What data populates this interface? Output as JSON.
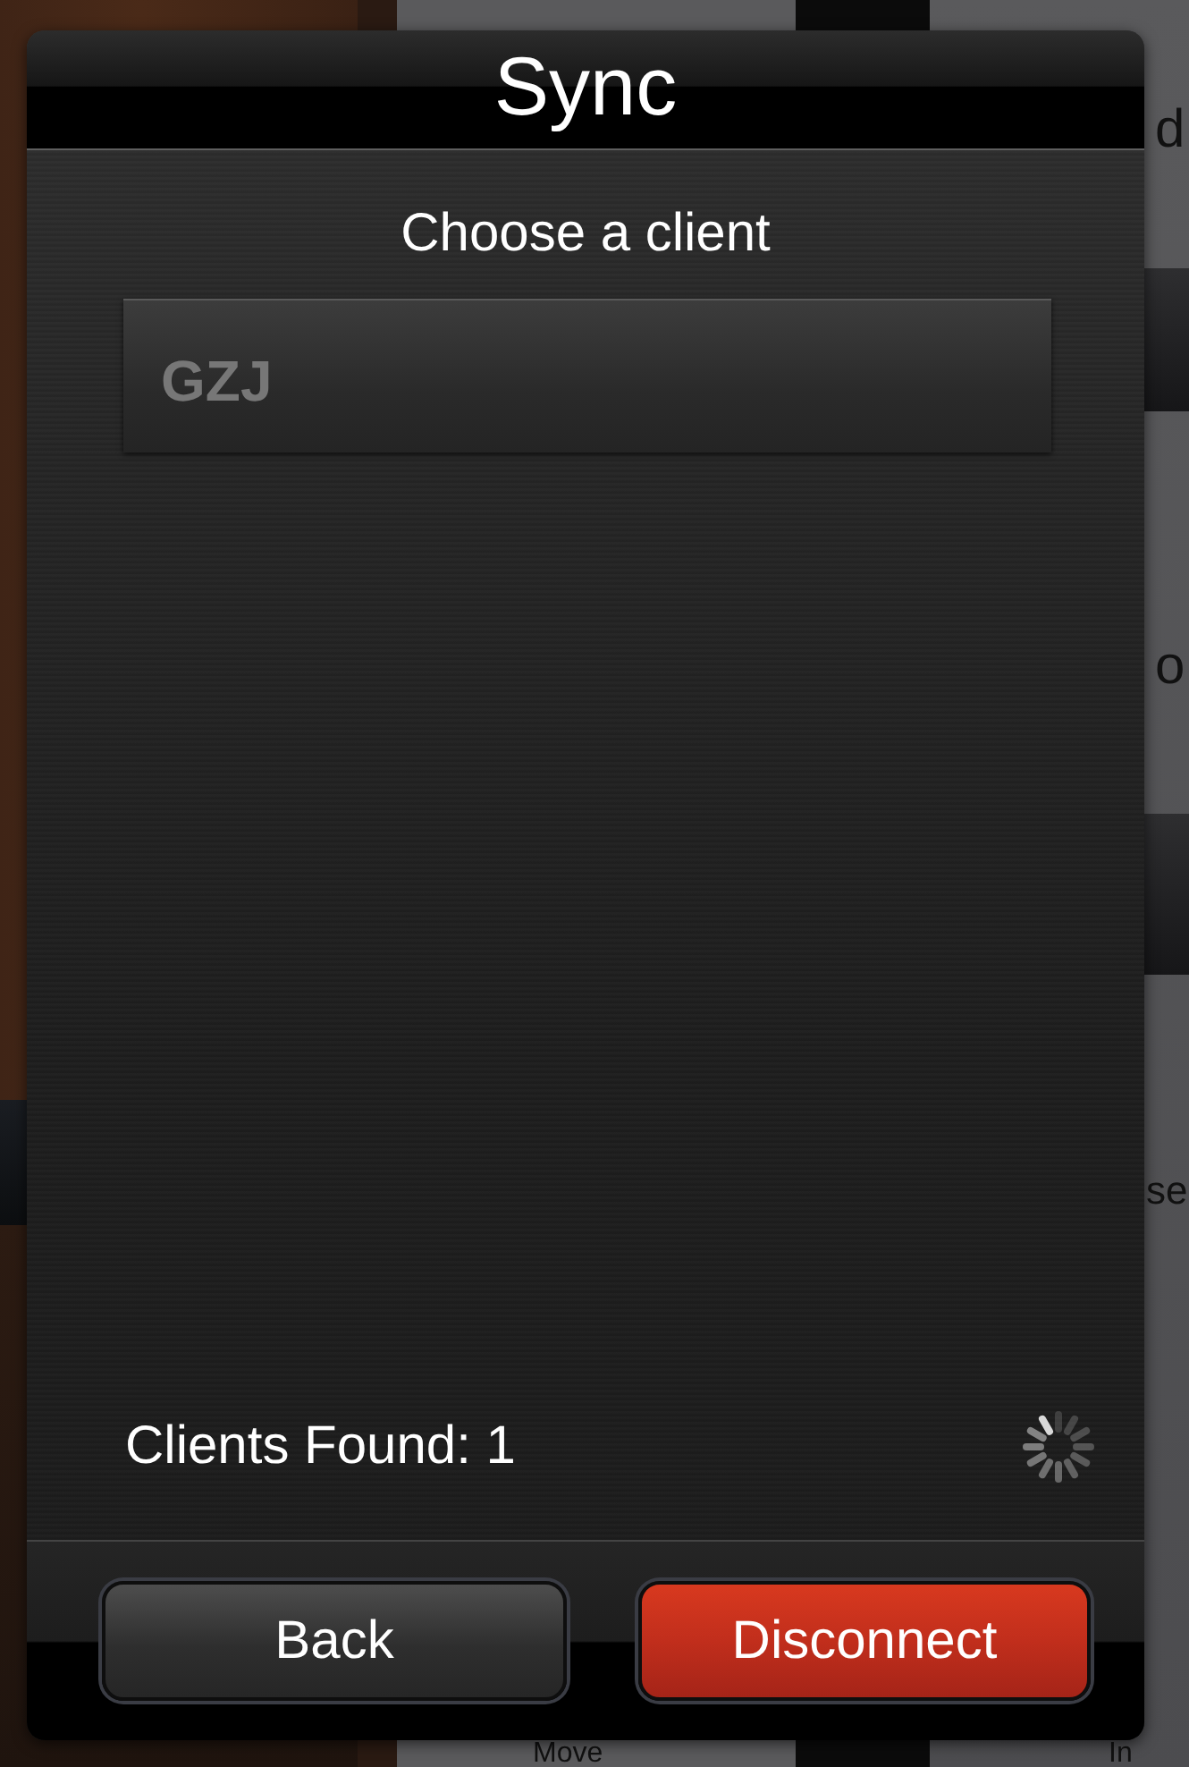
{
  "background": {
    "right_edge_texts": [
      "d",
      "o",
      "se"
    ],
    "bottom_texts": [
      "Move",
      "In"
    ]
  },
  "dialog": {
    "title": "Sync",
    "heading": "Choose a client",
    "clients": [
      {
        "name": "GZJ",
        "selected": false
      }
    ],
    "status": "Clients Found: 1",
    "searching": true,
    "buttons": [
      {
        "label": "Back",
        "kind": "default"
      },
      {
        "label": "Disconnect",
        "kind": "destructive"
      }
    ]
  }
}
